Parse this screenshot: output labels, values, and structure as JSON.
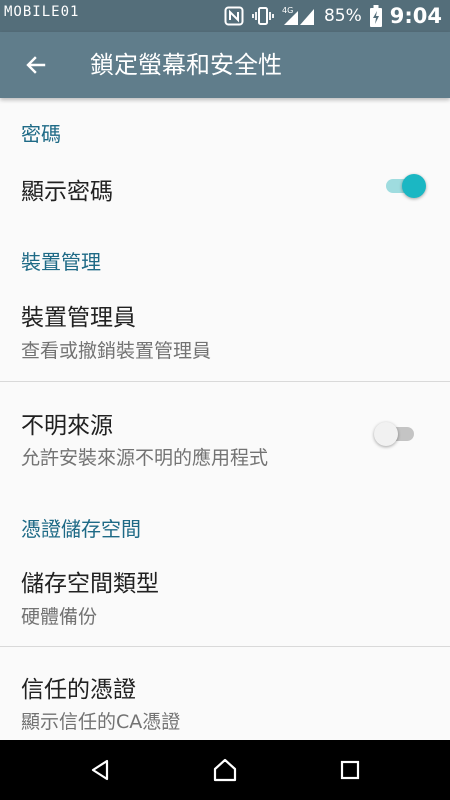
{
  "status_bar": {
    "watermark": "MOBILE01",
    "battery_percent": "85%",
    "time": "9:04",
    "network_label": "4G",
    "icons": [
      "nfc-icon",
      "vibrate-icon",
      "signal-icon",
      "battery-charging-icon"
    ]
  },
  "app_bar": {
    "title": "鎖定螢幕和安全性",
    "back_icon": "arrow-back-icon"
  },
  "sections": {
    "password": {
      "header": "密碼",
      "show_password": {
        "title": "顯示密碼",
        "enabled": true
      }
    },
    "device_admin": {
      "header": "裝置管理",
      "admins": {
        "title": "裝置管理員",
        "summary": "查看或撤銷裝置管理員"
      },
      "unknown_sources": {
        "title": "不明來源",
        "summary": "允許安裝來源不明的應用程式",
        "enabled": false
      }
    },
    "credential_storage": {
      "header": "憑證儲存空間",
      "storage_type": {
        "title": "儲存空間類型",
        "summary": "硬體備份"
      },
      "trusted_credentials": {
        "title": "信任的憑證",
        "summary": "顯示信任的CA憑證"
      }
    }
  },
  "nav_bar": {
    "icons": [
      "back-triangle-icon",
      "home-icon",
      "recents-icon"
    ]
  },
  "colors": {
    "status_bar": "#546e7a",
    "app_bar": "#607d8b",
    "section_header": "#1e6a86",
    "toggle_on": "#1bb7c3",
    "toggle_off": "#f1f1f1"
  }
}
